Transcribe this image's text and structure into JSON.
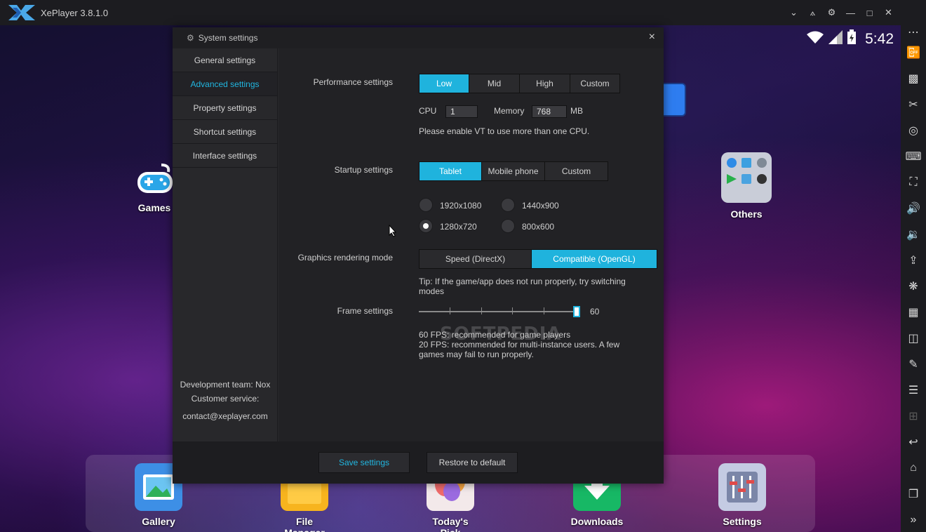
{
  "window": {
    "title": "XePlayer 3.8.1.0",
    "controls": [
      "chevron-down-icon",
      "pin-icon",
      "gear-icon",
      "minimize-icon",
      "maximize-icon",
      "close-icon"
    ]
  },
  "android": {
    "clock": "5:42",
    "desktop_icons": [
      {
        "label": "Games",
        "icon": "gamepad-icon"
      },
      {
        "label": "Others",
        "icon": "folder-icon"
      }
    ],
    "dock": [
      {
        "label": "Gallery",
        "icon": "gallery-icon"
      },
      {
        "label": "File Manager",
        "icon": "file-manager-icon"
      },
      {
        "label": "Today's Pick",
        "icon": "balloons-icon"
      },
      {
        "label": "Downloads",
        "icon": "download-icon"
      },
      {
        "label": "Settings",
        "icon": "settings-icon"
      }
    ]
  },
  "dialog": {
    "title": "System settings",
    "nav": [
      {
        "label": "General settings"
      },
      {
        "label": "Advanced settings"
      },
      {
        "label": "Property settings"
      },
      {
        "label": "Shortcut settings"
      },
      {
        "label": "Interface settings"
      }
    ],
    "footer_info": {
      "team": "Development team: Nox",
      "service": "Customer service:",
      "email": "contact@xeplayer.com"
    },
    "performance": {
      "label": "Performance settings",
      "options": [
        "Low",
        "Mid",
        "High",
        "Custom"
      ],
      "selected": "Low",
      "cpu_label": "CPU",
      "cpu_value": "1",
      "memory_label": "Memory",
      "memory_value": "768",
      "memory_unit": "MB",
      "note": "Please enable VT to use more than one CPU."
    },
    "startup": {
      "label": "Startup settings",
      "options": [
        "Tablet",
        "Mobile phone",
        "Custom"
      ],
      "selected": "Tablet",
      "resolutions": [
        "1920x1080",
        "1440x900",
        "1280x720",
        "800x600"
      ],
      "selected_resolution": "1280x720"
    },
    "graphics": {
      "label": "Graphics rendering mode",
      "options": [
        "Speed (DirectX)",
        "Compatible (OpenGL)"
      ],
      "selected": "Compatible (OpenGL)",
      "tip_line1": "Tip: If the game/app does not run properly, try switching",
      "tip_line2": "modes"
    },
    "frame": {
      "label": "Frame settings",
      "value": "60",
      "note1": "60 FPS: recommended for game players",
      "note2": "20 FPS: recommended for multi-instance users. A few",
      "note3": "games may fail to run properly."
    },
    "buttons": {
      "save": "Save settings",
      "restore": "Restore to default"
    },
    "watermark": "SOFTPEDIA"
  },
  "colors": {
    "accent": "#1fb3dd",
    "dialog_bg": "#28282b",
    "titlebar_bg": "#1c1c20"
  }
}
